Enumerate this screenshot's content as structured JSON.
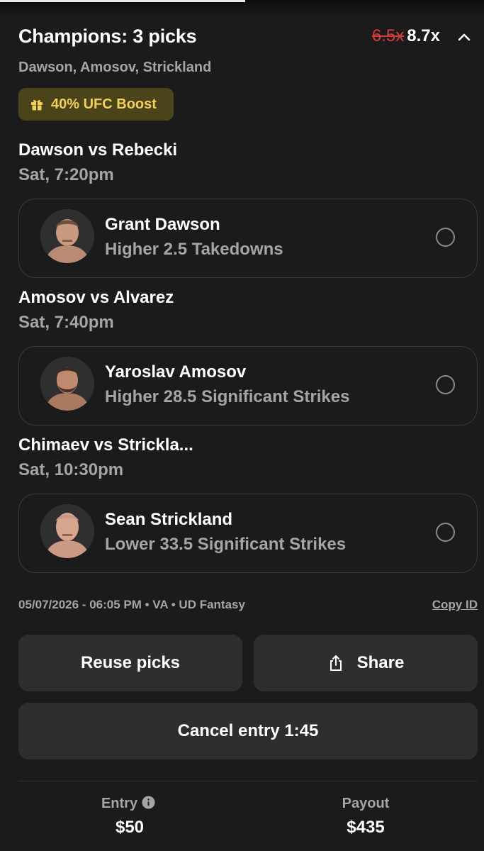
{
  "header": {
    "title": "Champions: 3 picks",
    "old_multiplier": "6.5x",
    "new_multiplier": "8.7x",
    "subtitle": "Dawson, Amosov, Strickland"
  },
  "boost": {
    "label": "40% UFC Boost",
    "icon": "gift-icon",
    "color": "#f2d05b"
  },
  "picks": [
    {
      "match": "Dawson vs Rebecki",
      "time": "Sat, 7:20pm",
      "player": "Grant Dawson",
      "line": "Higher 2.5  Takedowns"
    },
    {
      "match": "Amosov vs Alvarez",
      "time": "Sat, 7:40pm",
      "player": "Yaroslav Amosov",
      "line": "Higher 28.5  Significant Strikes"
    },
    {
      "match": "Chimaev vs Strickla...",
      "time": "Sat, 10:30pm",
      "player": "Sean Strickland",
      "line": "Lower 33.5  Significant Strikes"
    }
  ],
  "meta": {
    "text": "05/07/2026 - 06:05 PM • VA • UD Fantasy",
    "copy_id": "Copy ID"
  },
  "actions": {
    "reuse": "Reuse picks",
    "share": "Share",
    "cancel": "Cancel entry 1:45"
  },
  "footer": {
    "entry_label": "Entry",
    "entry_value": "$50",
    "payout_label": "Payout",
    "payout_value": "$435"
  },
  "colors": {
    "background": "#1b1b1c",
    "strike": "#d83b3b",
    "boost_bg": "#4b431a"
  }
}
